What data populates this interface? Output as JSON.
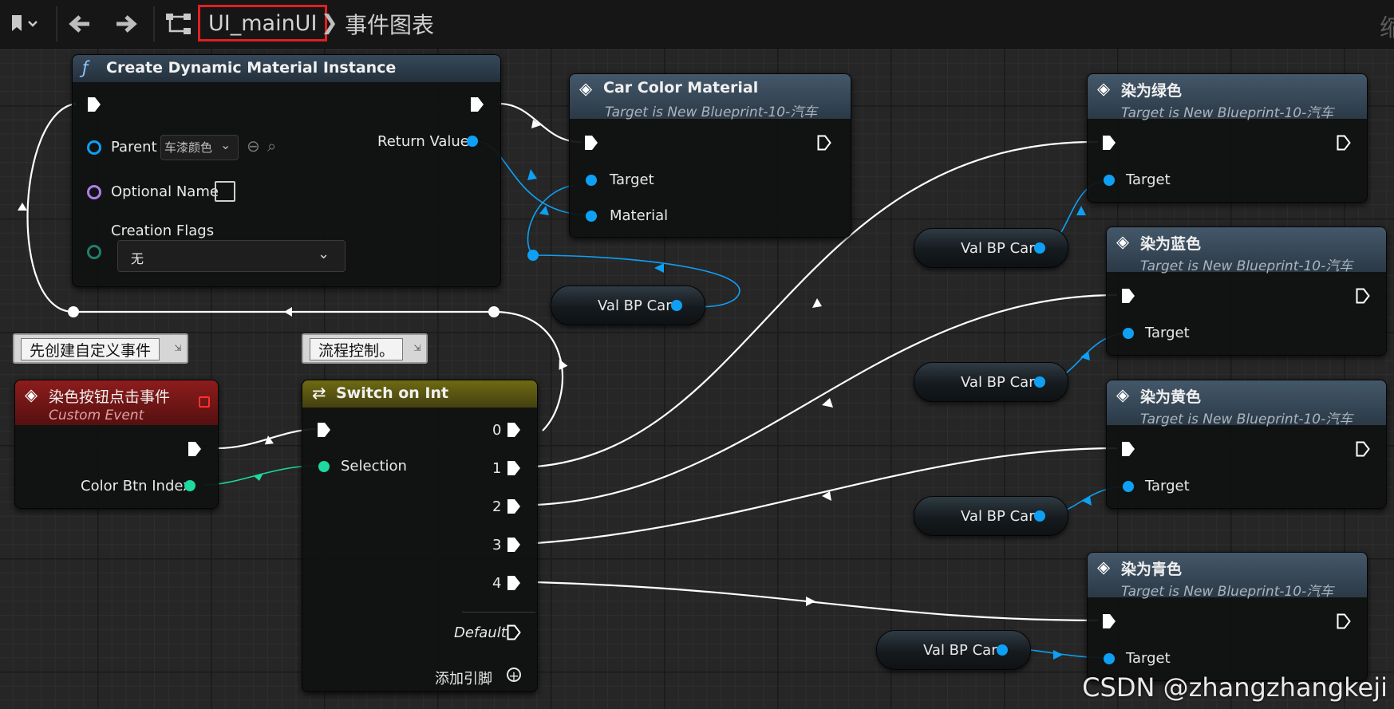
{
  "toolbar": {
    "bookmark_icon": "bookmark-icon",
    "back_icon": "arrow-left-icon",
    "forward_icon": "arrow-right-icon",
    "graph_icon": "blueprint-hierarchy-icon",
    "breadcrumb_main": "UI_mainUI",
    "breadcrumb_graph": "事件图表",
    "right_text": "缩"
  },
  "create_material": {
    "title": "Create Dynamic Material Instance",
    "parent_label": "Parent",
    "parent_value": "车漆颜色",
    "optional_name_label": "Optional Name",
    "creation_flags_label": "Creation Flags",
    "creation_flags_value": "无",
    "return_value_label": "Return Value"
  },
  "car_color_material": {
    "title": "Car Color Material",
    "subtitle": "Target is New Blueprint-10-汽车",
    "target_label": "Target",
    "material_label": "Material"
  },
  "variable_label": "Val BP Car",
  "color_nodes": [
    {
      "title": "染为绿色",
      "subtitle": "Target is New Blueprint-10-汽车",
      "target_label": "Target"
    },
    {
      "title": "染为蓝色",
      "subtitle": "Target is New Blueprint-10-汽车",
      "target_label": "Target"
    },
    {
      "title": "染为黄色",
      "subtitle": "Target is New Blueprint-10-汽车",
      "target_label": "Target"
    },
    {
      "title": "染为青色",
      "subtitle": "Target is New Blueprint-10-汽车",
      "target_label": "Target"
    }
  ],
  "comments": {
    "left": "先创建自定义事件",
    "middle": "流程控制。"
  },
  "custom_event": {
    "title": "染色按钮点击事件",
    "subtitle": "Custom Event",
    "output_label": "Color Btn Index"
  },
  "switch_node": {
    "title": "Switch on Int",
    "selection_label": "Selection",
    "outputs": [
      "0",
      "1",
      "2",
      "3",
      "4"
    ],
    "default_label": "Default",
    "add_pin_label": "添加引脚"
  },
  "watermark": "CSDN @zhangzhangkeji",
  "colors": {
    "exec_wire": "#ffffff",
    "object_pin": "#0ea0f5",
    "int_pin": "#1ed9a0",
    "name_pin": "#b07cf0",
    "highlight_box": "#e02020"
  }
}
